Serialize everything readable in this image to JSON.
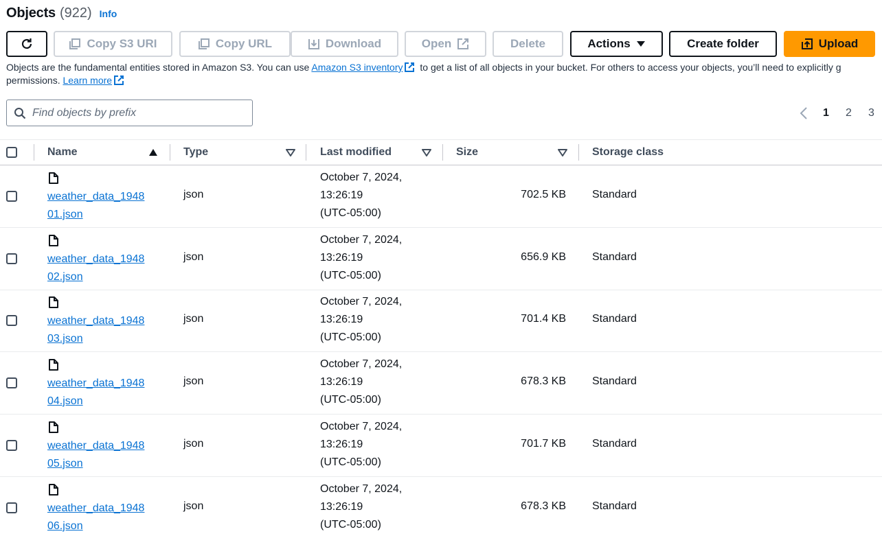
{
  "header": {
    "title": "Objects",
    "count": "(922)",
    "info": "Info"
  },
  "toolbar": {
    "copy_s3_uri": "Copy S3 URI",
    "copy_url": "Copy URL",
    "download": "Download",
    "open": "Open",
    "delete": "Delete",
    "actions": "Actions",
    "create_folder": "Create folder",
    "upload": "Upload"
  },
  "description": {
    "part1": "Objects are the fundamental entities stored in Amazon S3. You can use ",
    "inventory_link": "Amazon S3 inventory",
    "part2": " to get a list of all objects in your bucket. For others to access your objects, you’ll need to explicitly g",
    "part3": "permissions. ",
    "learn_more": "Learn more"
  },
  "search": {
    "placeholder": "Find objects by prefix"
  },
  "pagination": {
    "pages": [
      "1",
      "2",
      "3"
    ],
    "current": "1"
  },
  "table": {
    "columns": {
      "name": "Name",
      "type": "Type",
      "last_modified": "Last modified",
      "size": "Size",
      "storage_class": "Storage class"
    },
    "rows": [
      {
        "name_line1": "weather_data_1948",
        "name_line2": "01.json",
        "type": "json",
        "date_line1": "October 7, 2024,",
        "date_line2": "13:26:19",
        "date_line3": "(UTC-05:00)",
        "size": "702.5 KB",
        "storage_class": "Standard"
      },
      {
        "name_line1": "weather_data_1948",
        "name_line2": "02.json",
        "type": "json",
        "date_line1": "October 7, 2024,",
        "date_line2": "13:26:19",
        "date_line3": "(UTC-05:00)",
        "size": "656.9 KB",
        "storage_class": "Standard"
      },
      {
        "name_line1": "weather_data_1948",
        "name_line2": "03.json",
        "type": "json",
        "date_line1": "October 7, 2024,",
        "date_line2": "13:26:19",
        "date_line3": "(UTC-05:00)",
        "size": "701.4 KB",
        "storage_class": "Standard"
      },
      {
        "name_line1": "weather_data_1948",
        "name_line2": "04.json",
        "type": "json",
        "date_line1": "October 7, 2024,",
        "date_line2": "13:26:19",
        "date_line3": "(UTC-05:00)",
        "size": "678.3 KB",
        "storage_class": "Standard"
      },
      {
        "name_line1": "weather_data_1948",
        "name_line2": "05.json",
        "type": "json",
        "date_line1": "October 7, 2024,",
        "date_line2": "13:26:19",
        "date_line3": "(UTC-05:00)",
        "size": "701.7 KB",
        "storage_class": "Standard"
      },
      {
        "name_line1": "weather_data_1948",
        "name_line2": "06.json",
        "type": "json",
        "date_line1": "October 7, 2024,",
        "date_line2": "13:26:19",
        "date_line3": "(UTC-05:00)",
        "size": "678.3 KB",
        "storage_class": "Standard"
      }
    ]
  },
  "icons": {
    "refresh": "refresh-icon",
    "copy": "copy-icon",
    "download": "download-icon",
    "external": "external-link-icon",
    "caret": "caret-down-icon",
    "upload": "upload-icon",
    "search": "search-icon",
    "file": "file-icon",
    "sort_asc": "sort-ascending-icon",
    "sort": "sort-icon",
    "chevron_left": "chevron-left-icon"
  },
  "colors": {
    "accent": "#ff9900",
    "link": "#0972d3",
    "text": "#0f141a",
    "disabled": "#9ba7b6"
  }
}
